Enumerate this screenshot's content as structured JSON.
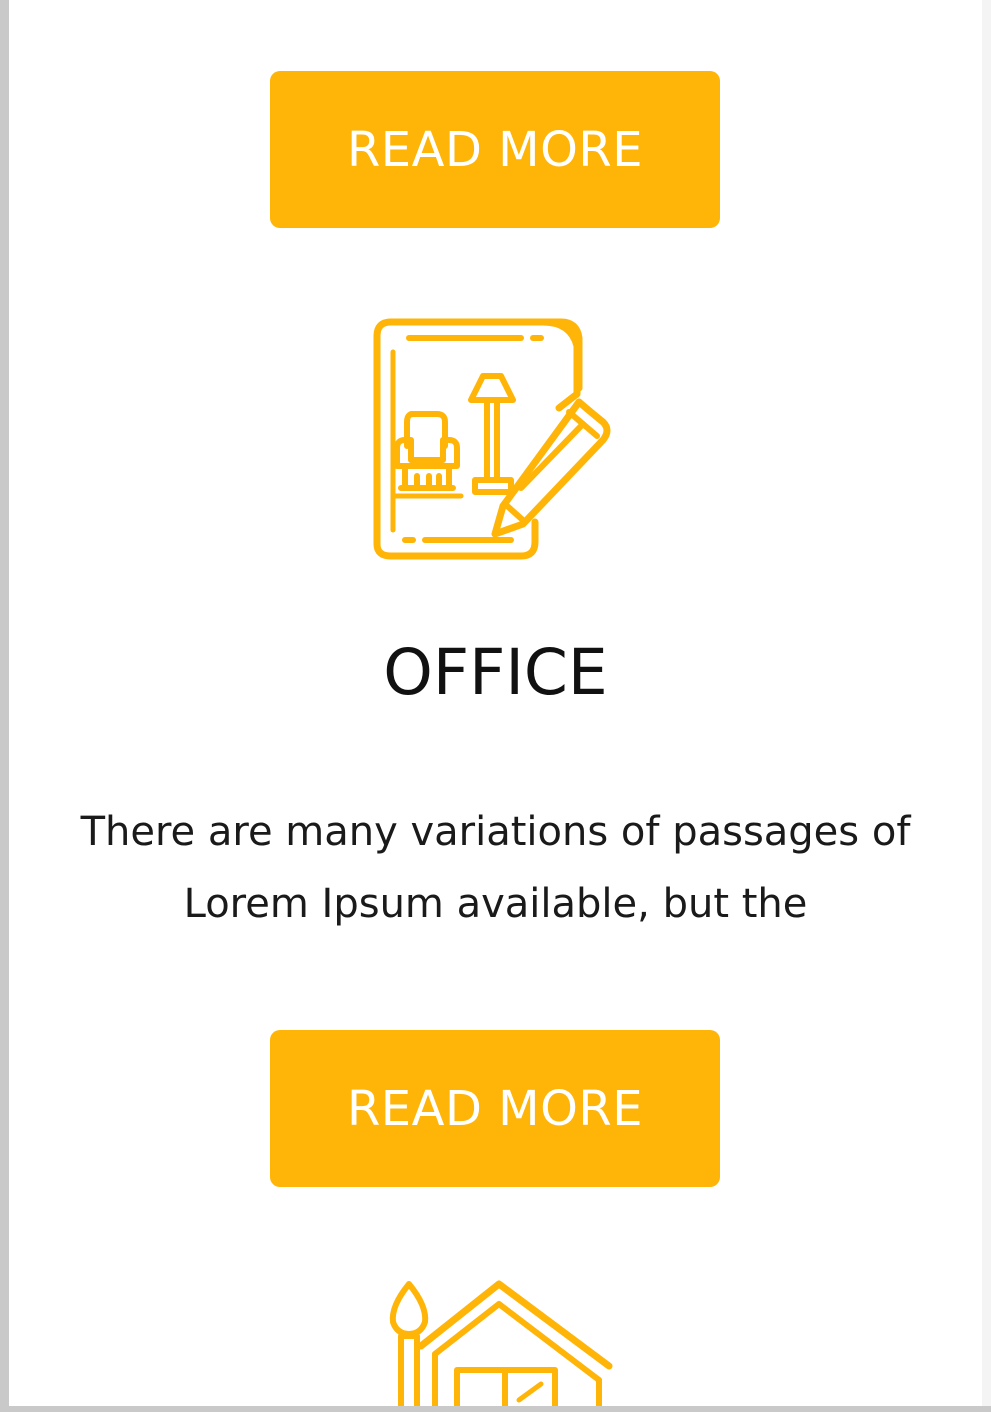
{
  "colors": {
    "accent": "#FFB408",
    "title": "#111111",
    "body_text": "#1a1a1a",
    "background": "#ffffff"
  },
  "cards": [
    {
      "button_label": "READ MORE"
    },
    {
      "icon": "office-design-icon",
      "title": "OFFICE",
      "description": "There are many variations of passages of Lorem Ipsum available, but the",
      "button_label": "READ MORE"
    },
    {
      "icon": "house-icon"
    }
  ]
}
